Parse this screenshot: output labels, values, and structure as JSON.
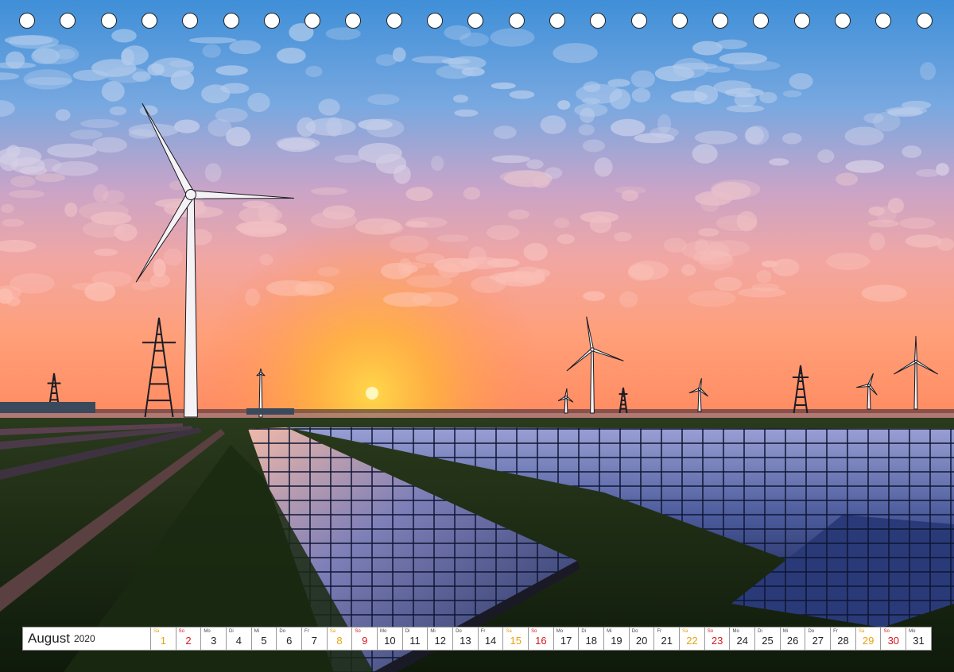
{
  "calendar": {
    "month": "August",
    "year": "2020",
    "days": [
      {
        "wd": "Sa",
        "num": "1",
        "type": "sat"
      },
      {
        "wd": "So",
        "num": "2",
        "type": "sun"
      },
      {
        "wd": "Mo",
        "num": "3",
        "type": "wk"
      },
      {
        "wd": "Di",
        "num": "4",
        "type": "wk"
      },
      {
        "wd": "Mi",
        "num": "5",
        "type": "wk"
      },
      {
        "wd": "Do",
        "num": "6",
        "type": "wk"
      },
      {
        "wd": "Fr",
        "num": "7",
        "type": "wk"
      },
      {
        "wd": "Sa",
        "num": "8",
        "type": "sat"
      },
      {
        "wd": "So",
        "num": "9",
        "type": "sun"
      },
      {
        "wd": "Mo",
        "num": "10",
        "type": "wk"
      },
      {
        "wd": "Di",
        "num": "11",
        "type": "wk"
      },
      {
        "wd": "Mi",
        "num": "12",
        "type": "wk"
      },
      {
        "wd": "Do",
        "num": "13",
        "type": "wk"
      },
      {
        "wd": "Fr",
        "num": "14",
        "type": "wk"
      },
      {
        "wd": "Sa",
        "num": "15",
        "type": "sat"
      },
      {
        "wd": "So",
        "num": "16",
        "type": "sun"
      },
      {
        "wd": "Mo",
        "num": "17",
        "type": "wk"
      },
      {
        "wd": "Di",
        "num": "18",
        "type": "wk"
      },
      {
        "wd": "Mi",
        "num": "19",
        "type": "wk"
      },
      {
        "wd": "Do",
        "num": "20",
        "type": "wk"
      },
      {
        "wd": "Fr",
        "num": "21",
        "type": "wk"
      },
      {
        "wd": "Sa",
        "num": "22",
        "type": "sat"
      },
      {
        "wd": "So",
        "num": "23",
        "type": "sun"
      },
      {
        "wd": "Mo",
        "num": "24",
        "type": "wk"
      },
      {
        "wd": "Di",
        "num": "25",
        "type": "wk"
      },
      {
        "wd": "Mi",
        "num": "26",
        "type": "wk"
      },
      {
        "wd": "Do",
        "num": "27",
        "type": "wk"
      },
      {
        "wd": "Fr",
        "num": "28",
        "type": "wk"
      },
      {
        "wd": "Sa",
        "num": "29",
        "type": "sat"
      },
      {
        "wd": "So",
        "num": "30",
        "type": "sun"
      },
      {
        "wd": "Mo",
        "num": "31",
        "type": "wk"
      }
    ]
  },
  "colors": {
    "saturday": "#e8a20c",
    "sunday": "#d7171f",
    "sky_top": "#4f9fe0",
    "sky_horizon": "#ff9a6a",
    "sun": "#fff6c0"
  },
  "icons": {
    "binding_hole": "binding-hole-icon"
  }
}
